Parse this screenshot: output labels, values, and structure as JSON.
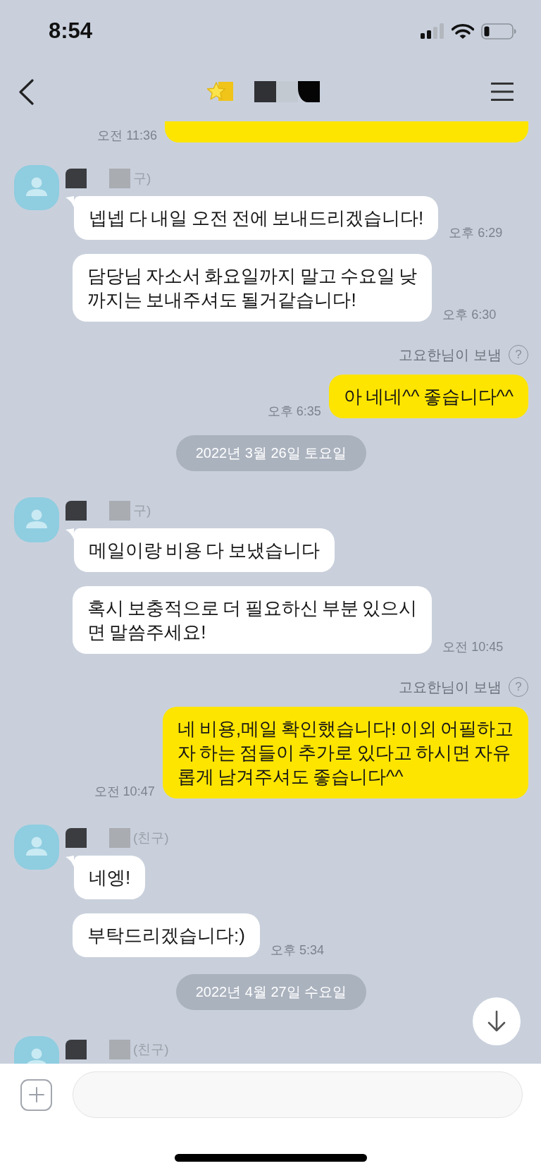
{
  "status_bar": {
    "time": "8:54"
  },
  "messages": [
    {
      "kind": "sent",
      "cut_off": true,
      "time": "오전 11:36"
    },
    {
      "kind": "group",
      "sender": "구)",
      "bubbles": [
        {
          "text": "넵넵 다 내일 오전 전에 보내드리겠습니다!",
          "time": "오후 6:29"
        },
        {
          "text": "담당님 자소서 화요일까지 말고 수요일 낮\n까지는 보내주셔도 될거같습니다!",
          "time": "오후 6:30"
        }
      ]
    },
    {
      "kind": "sent_label",
      "text": "고요한님이 보냄",
      "icon": "?"
    },
    {
      "kind": "sent",
      "cut_off": false,
      "text": "아 네네^^ 좋습니다^^",
      "time": "오후 6:35"
    },
    {
      "kind": "date",
      "text": "2022년 3월 26일 토요일"
    },
    {
      "kind": "group",
      "sender": "구)",
      "bubbles": [
        {
          "text": "메일이랑 비용 다 보냈습니다"
        },
        {
          "text": "혹시 보충적으로 더 필요하신 부분 있으시\n면 말씀주세요!",
          "time": "오전 10:45"
        }
      ]
    },
    {
      "kind": "sent_label",
      "text": "고요한님이 보냄",
      "icon": "?"
    },
    {
      "kind": "sent",
      "cut_off": false,
      "text": "네 비용,메일 확인했습니다! 이외 어필하고\n자 하는 점들이 추가로 있다고 하시면 자유\n롭게 남겨주셔도 좋습니다^^",
      "time": "오전 10:47"
    },
    {
      "kind": "group",
      "sender": "(친구)",
      "bubbles": [
        {
          "text": "네엥!"
        },
        {
          "text": "부탁드리겠습니다:)",
          "time": "오후 5:34"
        }
      ]
    },
    {
      "kind": "date",
      "text": "2022년 4월 27일 수요일"
    },
    {
      "kind": "group",
      "sender": "(친구)"
    }
  ]
}
